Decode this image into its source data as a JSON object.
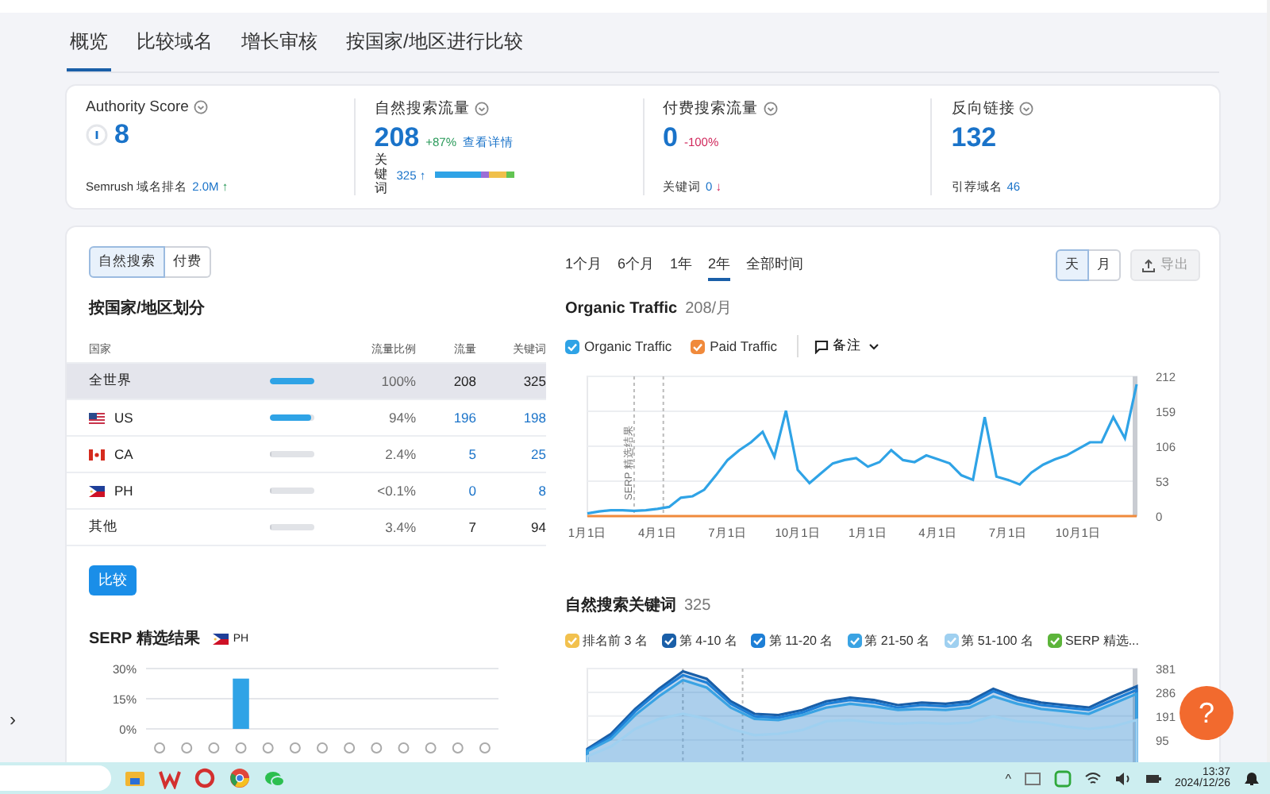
{
  "tabs": [
    {
      "label": "概览",
      "selected": true
    },
    {
      "label": "比较域名",
      "selected": false
    },
    {
      "label": "增长审核",
      "selected": false
    },
    {
      "label": "按国家/地区进行比较",
      "selected": false
    }
  ],
  "summary": [
    {
      "kind": "authority",
      "title": "Authority Score",
      "value": "8",
      "footer_label": "Semrush 域名排名",
      "footer_value": "2.0M",
      "footer_arrow": "↑"
    },
    {
      "kind": "organic",
      "title": "自然搜索流量",
      "value": "208",
      "change": "+87%",
      "link": "查看详情",
      "keywords_label": "关键词",
      "keywords_value": "325",
      "keywords_arrow": "↑"
    },
    {
      "kind": "paid",
      "title": "付费搜索流量",
      "value": "0",
      "change": "-100%",
      "footer_label": "关键词",
      "footer_value": "0",
      "footer_arrow": "↓"
    },
    {
      "kind": "backlinks",
      "title": "反向链接",
      "value": "132",
      "footer_label": "引荐域名",
      "footer_value": "46"
    }
  ],
  "source_toggle": [
    {
      "label": "自然搜索",
      "selected": true
    },
    {
      "label": "付费",
      "selected": false
    }
  ],
  "countries": {
    "title": "按国家/地区划分",
    "columns": [
      "国家",
      "流量比例",
      "流量",
      "关键词"
    ],
    "rows": [
      {
        "name": "全世界",
        "kind": "none",
        "level": 1,
        "share": "100%",
        "traffic": "208",
        "keywords": "325",
        "linked": false,
        "selected": true
      },
      {
        "name": "US",
        "kind": "us",
        "level": 0.94,
        "share": "94%",
        "traffic": "196",
        "keywords": "198",
        "linked": true,
        "selected": false
      },
      {
        "name": "CA",
        "kind": "ca",
        "level": 0.024,
        "share": "2.4%",
        "traffic": "5",
        "keywords": "25",
        "linked": true,
        "selected": false
      },
      {
        "name": "PH",
        "kind": "ph",
        "level": 0.001,
        "share": "<0.1%",
        "traffic": "0",
        "keywords": "8",
        "linked": true,
        "selected": false
      },
      {
        "name": "其他",
        "kind": "none",
        "level": 0.034,
        "share": "3.4%",
        "traffic": "7",
        "keywords": "94",
        "linked": false,
        "selected": false
      }
    ]
  },
  "compare_button": "比较",
  "serp": {
    "title": "SERP 精选结果",
    "region": "PH",
    "chart_data": {
      "type": "bar",
      "values": [
        0,
        0,
        0,
        25,
        0,
        0,
        0,
        0,
        0,
        0,
        0,
        0,
        0
      ],
      "yticks": [
        {
          "value": 0,
          "label": "0%"
        },
        {
          "value": 15,
          "label": "15%"
        },
        {
          "value": 30,
          "label": "30%"
        }
      ],
      "ylim": [
        0,
        30
      ],
      "grid": true
    }
  },
  "periods": [
    {
      "label": "1个月",
      "selected": false
    },
    {
      "label": "6个月",
      "selected": false
    },
    {
      "label": "1年",
      "selected": false
    },
    {
      "label": "2年",
      "selected": true
    },
    {
      "label": "全部时间",
      "selected": false
    }
  ],
  "granularity": [
    {
      "label": "天",
      "selected": true
    },
    {
      "label": "月",
      "selected": false
    }
  ],
  "export_button": {
    "label": "导出",
    "disabled": true
  },
  "organic_chart": {
    "title": "Organic Traffic",
    "subtitle": "208/月",
    "notes_label": "备注",
    "marker_label": "SERP 精选结果",
    "legend": [
      {
        "checked": true
      },
      {
        "checked": true
      }
    ],
    "chart_data": {
      "type": "line",
      "grid": true,
      "categories": [
        "1月1日",
        null,
        null,
        null,
        null,
        null,
        "4月1日",
        null,
        null,
        null,
        null,
        null,
        "7月1日",
        null,
        null,
        null,
        null,
        null,
        "10月1日",
        null,
        null,
        null,
        null,
        null,
        "1月1日",
        null,
        null,
        null,
        null,
        null,
        "4月1日",
        null,
        null,
        null,
        null,
        null,
        "7月1日",
        null,
        null,
        null,
        null,
        null,
        "10月1日",
        null,
        null,
        null,
        null,
        null
      ],
      "series": [
        {
          "name": "Organic Traffic",
          "color": "#2fa3e6",
          "values": [
            4,
            7,
            9,
            9,
            8,
            9,
            11,
            14,
            28,
            30,
            40,
            62,
            85,
            100,
            112,
            128,
            90,
            160,
            70,
            50,
            65,
            80,
            85,
            88,
            75,
            82,
            100,
            85,
            82,
            92,
            86,
            80,
            62,
            55,
            150,
            60,
            55,
            48,
            66,
            78,
            86,
            92,
            102,
            112,
            112,
            150,
            118,
            200
          ]
        },
        {
          "name": "Paid Traffic",
          "color": "#f08a3c",
          "values": [
            0,
            0,
            0,
            0,
            0,
            0,
            0,
            0,
            0,
            0,
            0,
            0,
            0,
            0,
            0,
            0,
            0,
            0,
            0,
            0,
            0,
            0,
            0,
            0,
            0,
            0,
            0,
            0,
            0,
            0,
            0,
            0,
            0,
            0,
            0,
            0,
            0,
            0,
            0,
            0,
            0,
            0,
            0,
            0,
            0,
            0,
            0,
            0
          ]
        }
      ],
      "ylim": [
        0,
        212
      ],
      "yticks": [
        0,
        53,
        106,
        159,
        212
      ]
    }
  },
  "keywords_chart": {
    "title": "自然搜索关键词",
    "count": "325",
    "legend": [
      {
        "checked": true
      },
      {
        "checked": true
      },
      {
        "checked": true
      },
      {
        "checked": true
      },
      {
        "checked": true
      },
      {
        "checked": true
      }
    ],
    "chart_data": {
      "type": "area",
      "grid": true,
      "series": [
        {
          "name": "排名前 3 名",
          "color": "#f2c14e",
          "values": [
            null,
            null,
            null,
            null,
            null,
            null,
            null,
            null,
            null,
            null,
            null,
            null,
            null,
            null,
            null,
            null,
            null,
            null,
            null,
            null,
            null,
            null,
            null,
            null
          ]
        },
        {
          "name": "第 4-10 名",
          "color": "#1a5fa8",
          "values": [
            60,
            120,
            220,
            300,
            370,
            340,
            250,
            200,
            195,
            215,
            250,
            265,
            255,
            235,
            245,
            240,
            250,
            300,
            265,
            245,
            235,
            225,
            270,
            310
          ]
        },
        {
          "name": "第 11-20 名",
          "color": "#1e7fd6",
          "values": [
            55,
            110,
            210,
            290,
            355,
            325,
            240,
            190,
            185,
            205,
            240,
            255,
            245,
            225,
            235,
            230,
            240,
            290,
            255,
            235,
            225,
            215,
            255,
            295
          ]
        },
        {
          "name": "第 21-50 名",
          "color": "#3aa3e3",
          "values": [
            50,
            100,
            195,
            270,
            335,
            305,
            225,
            180,
            175,
            195,
            225,
            240,
            230,
            215,
            220,
            215,
            225,
            270,
            240,
            220,
            210,
            200,
            240,
            280
          ]
        },
        {
          "name": "第 51-100 名",
          "color": "#9fd0f0",
          "values": [
            30,
            70,
            140,
            180,
            200,
            180,
            140,
            115,
            120,
            135,
            170,
            175,
            165,
            160,
            165,
            160,
            165,
            190,
            170,
            165,
            150,
            140,
            150,
            175
          ]
        },
        {
          "name": "SERP 精选...",
          "color": "#5cb43a",
          "values": [
            null,
            null,
            null,
            null,
            null,
            null,
            null,
            null,
            null,
            null,
            null,
            null,
            null,
            null,
            null,
            null,
            null,
            null,
            null,
            null,
            null,
            null,
            null,
            null
          ]
        }
      ],
      "ylim": [
        0,
        381
      ],
      "yticks": [
        95,
        191,
        286,
        381
      ]
    }
  },
  "help_button": "?",
  "side_arrow": "›",
  "taskbar": {
    "time": "13:37",
    "date": "2024/12/26",
    "tray_caret": "^"
  }
}
